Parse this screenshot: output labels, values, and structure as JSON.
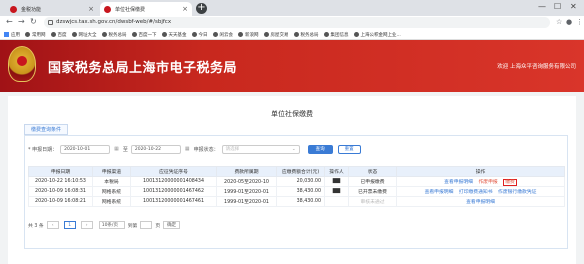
{
  "browser": {
    "tabs": [
      {
        "label": "金税功能",
        "active": false
      },
      {
        "label": "单位社保缴费",
        "active": true
      }
    ],
    "url": "dzswjcs.tax.sh.gov.cn/dwsbf-web/#/sbjfcx",
    "window_controls": [
      "—",
      "☐",
      "✕"
    ],
    "bookmarks": [
      "应用",
      "常用网",
      "百度",
      "网址大全",
      "税务总局",
      "百度一下",
      "天天基金",
      "今日",
      "闲云会",
      "新浪网",
      "房屋交易",
      "税务总局",
      "集团信息",
      "上海公积金网上业..."
    ]
  },
  "header": {
    "site_title": "国家税务总局上海市电子税务局",
    "welcome": "欢迎 上海众平咨询服务有限公司"
  },
  "page": {
    "title": "单位社保缴费",
    "subtab": "缴费查询条件"
  },
  "filters": {
    "date_label": "* 申报日期：",
    "date_from": "2020-10-01",
    "date_sep": "至",
    "date_to": "2020-10-22",
    "status_label": "申报状态：",
    "status_placeholder": "请选择",
    "query_btn": "查询",
    "reset_btn": "重置"
  },
  "table": {
    "columns": [
      "申报日期",
      "申报渠道",
      "应征凭证序号",
      "费款所属期",
      "应缴费额合计(元)",
      "操作人",
      "状态",
      "操作"
    ],
    "rows": [
      {
        "date": "2020-10-22 16:10:53",
        "channel": "本税局",
        "voucher": "10013120000001408434",
        "period": "2020-05至2020-10",
        "amount": "20,030.00",
        "operator": "▇▇",
        "status": "已申报缴费",
        "ops": [
          {
            "label": "查看申报明细",
            "style": "blue"
          },
          {
            "label": "作废申报",
            "style": "red"
          },
          {
            "label": "缴费",
            "style": "boxed"
          }
        ]
      },
      {
        "date": "2020-10-09 16:08:31",
        "channel": "网格系统",
        "voucher": "10013120000001467462",
        "period": "1999-01至2020-01",
        "amount": "38,430.00",
        "operator": "▇▇",
        "status": "已开票未缴费",
        "ops": [
          {
            "label": "查看申报明细",
            "style": "blue"
          },
          {
            "label": "打印缴费通知书",
            "style": "blue"
          },
          {
            "label": "作废银行缴款凭证",
            "style": "blue"
          }
        ]
      },
      {
        "date": "2020-10-09 16:08:21",
        "channel": "网格系统",
        "voucher": "10013120000001467461",
        "period": "1999-01至2020-01",
        "amount": "38,430.00",
        "operator": "",
        "status": "审核未通过",
        "ops": [
          {
            "label": "查看申报明细",
            "style": "blue"
          }
        ]
      }
    ]
  },
  "pager": {
    "total": "共 3 条",
    "prev": "‹",
    "page": "1",
    "next": "›",
    "page_size": "10条/页",
    "goto_label": "到第",
    "page_unit": "页",
    "go_btn": "确定"
  },
  "colors": {
    "header_red": "#c8281e",
    "accent_blue": "#3a7bd5",
    "table_header": "#e8f0fb",
    "highlight_red": "#e02020"
  }
}
